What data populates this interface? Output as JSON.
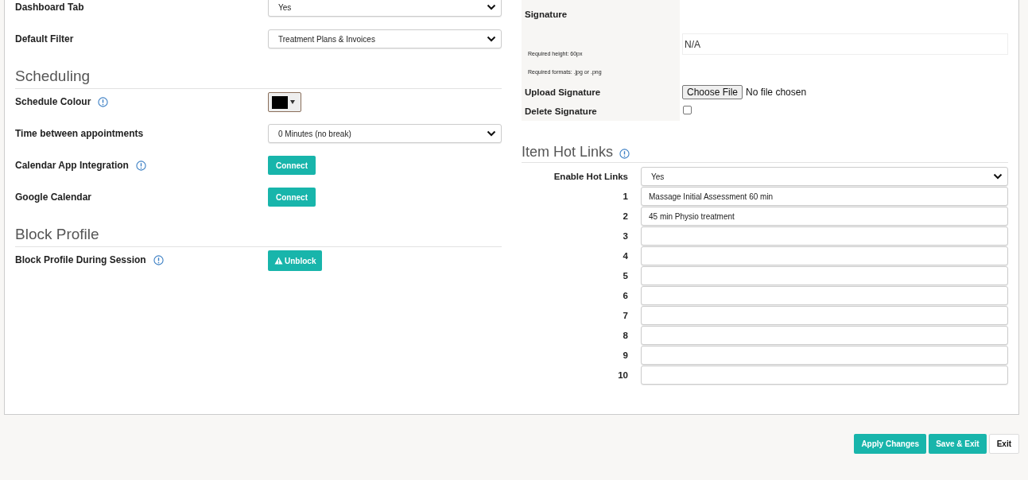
{
  "settings": {
    "sections": [
      {
        "rows": [
          {
            "label": "Dashboard Tab",
            "info": false,
            "kind": "select",
            "value": "Yes"
          },
          {
            "label": "Default Filter",
            "info": false,
            "kind": "select",
            "value": "Treatment Plans & Invoices"
          }
        ]
      },
      {
        "heading": "Scheduling",
        "rows": [
          {
            "label": "Schedule Colour",
            "info": true,
            "kind": "color",
            "color": "#000000"
          },
          {
            "label": "Time between appointments",
            "info": false,
            "kind": "select",
            "value": "0 Minutes (no break)"
          },
          {
            "label": "Calendar App Integration",
            "info": true,
            "kind": "button",
            "value": "Connect",
            "warning": false
          },
          {
            "label": "Google Calendar",
            "info": false,
            "kind": "button",
            "value": "Connect",
            "warning": false
          }
        ]
      },
      {
        "heading": "Block Profile",
        "rows": [
          {
            "label": "Block Profile During Session",
            "info": true,
            "kind": "button",
            "value": "Unblock",
            "warning": true
          }
        ]
      }
    ]
  },
  "signature": {
    "label": "Signature",
    "preview": "N/A",
    "notes": [
      "Required height: 60px",
      "Required formats: .jpg or .png"
    ],
    "upload": {
      "label": "Upload Signature",
      "button": "Choose File",
      "status": "No file chosen"
    },
    "delete": {
      "label": "Delete Signature",
      "checked": false
    }
  },
  "hot_links": {
    "heading": "Item Hot Links",
    "info": true,
    "enable": {
      "label": "Enable Hot Links",
      "value": "Yes"
    },
    "links": [
      {
        "number": "1",
        "value": "Massage Initial Assessment 60 min"
      },
      {
        "number": "2",
        "value": "45 min Physio treatment"
      },
      {
        "number": "3"
      },
      {
        "number": "4"
      },
      {
        "number": "5"
      },
      {
        "number": "6"
      },
      {
        "number": "7"
      },
      {
        "number": "8"
      },
      {
        "number": "9"
      },
      {
        "number": "10"
      }
    ]
  },
  "footer": {
    "buttons": [
      {
        "label": "Apply Changes",
        "kind": "primary"
      },
      {
        "label": "Save & Exit",
        "kind": "primary"
      },
      {
        "label": "Exit",
        "kind": "default"
      }
    ]
  }
}
